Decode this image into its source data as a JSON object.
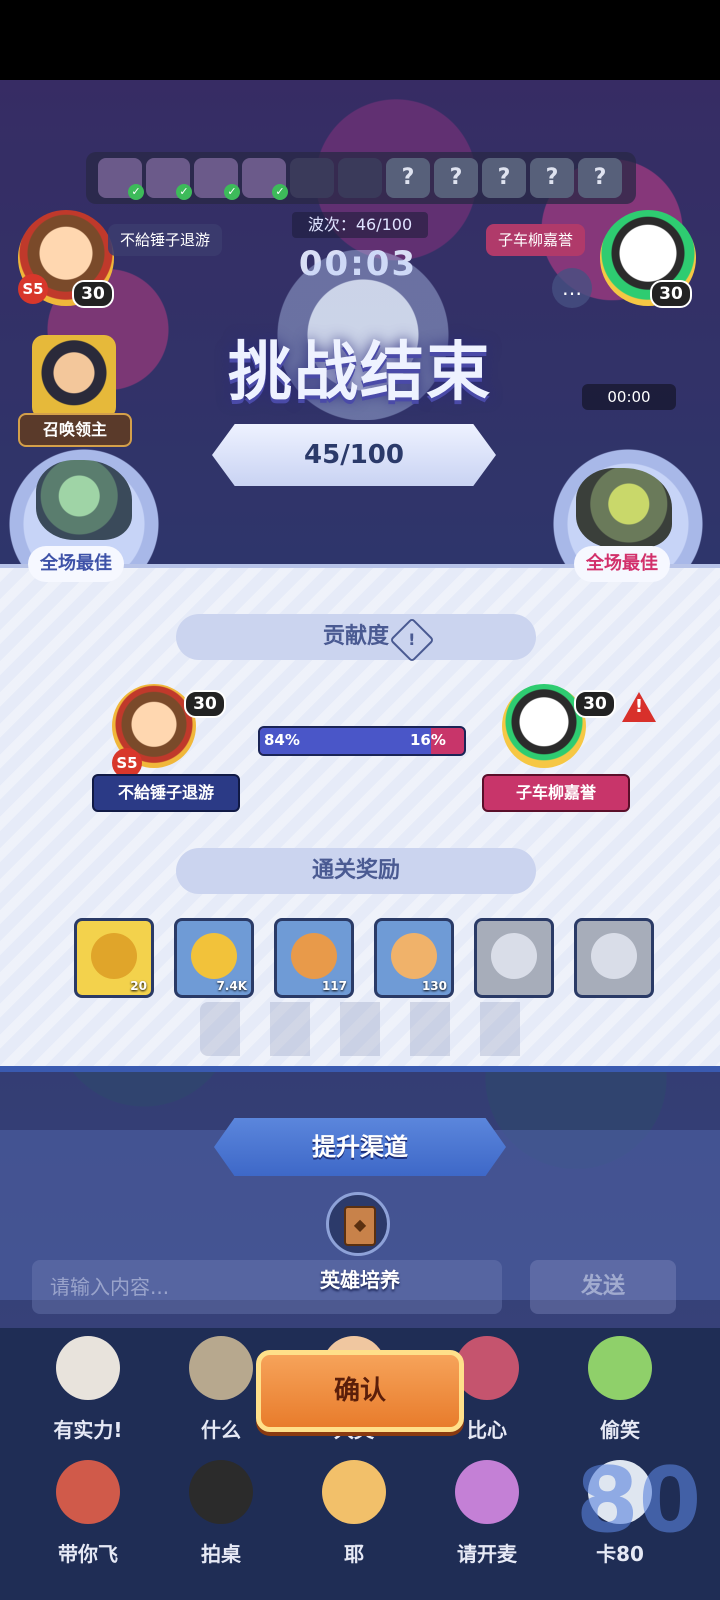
{
  "hud": {
    "wave_text": "波次：46/100",
    "timer": "00:03",
    "right_timer": "00:00",
    "wave_slots": [
      "done",
      "done",
      "done",
      "done",
      "current",
      "current",
      "unknown",
      "unknown",
      "unknown",
      "unknown",
      "unknown"
    ],
    "unknown_glyph": "?"
  },
  "players": {
    "p1": {
      "name": "不給锤子退游",
      "level": "30",
      "rank": "S5"
    },
    "p2": {
      "name": "子车柳嘉誉",
      "level": "30"
    }
  },
  "summon_lord": {
    "label": "召唤领主"
  },
  "result": {
    "title": "挑战结束",
    "score": "45/100",
    "mvp_label": "全场最佳"
  },
  "contribution": {
    "title": "贡献度",
    "info_glyph": "!",
    "p1_percent_label": "84%",
    "p2_percent_label": "16%",
    "p1_fraction": 0.84,
    "warning_glyph": "!"
  },
  "rewards": {
    "title": "通关奖励",
    "items": [
      {
        "icon": "key-icon",
        "count": "20",
        "style": "gold"
      },
      {
        "icon": "gold-coin-icon",
        "count": "7.4K",
        "style": "blue"
      },
      {
        "icon": "trophy-icon",
        "count": "117",
        "style": "blue"
      },
      {
        "icon": "cat-icon",
        "count": "130",
        "style": "blue"
      },
      {
        "icon": "star-emblem-icon",
        "count": "",
        "style": "grey"
      },
      {
        "icon": "crest-emblem-icon",
        "count": "",
        "style": "grey"
      }
    ]
  },
  "upgrade": {
    "title": "提升渠道",
    "hero_training": "英雄培养"
  },
  "chat": {
    "placeholder": "请输入内容...",
    "send": "发送"
  },
  "confirm": "确认",
  "emojis": {
    "row1": [
      "有实力!",
      "什么",
      "大哭",
      "比心",
      "偷笑"
    ],
    "row2": [
      "带你飞",
      "拍桌",
      "耶",
      "请开麦",
      "卡80"
    ],
    "big_number": "80"
  },
  "colors": {
    "p1_color": "#2b3a86",
    "p2_color": "#c8356a",
    "confirm_orange": "#e87c2c",
    "panel_bg": "#e6ebf8"
  }
}
